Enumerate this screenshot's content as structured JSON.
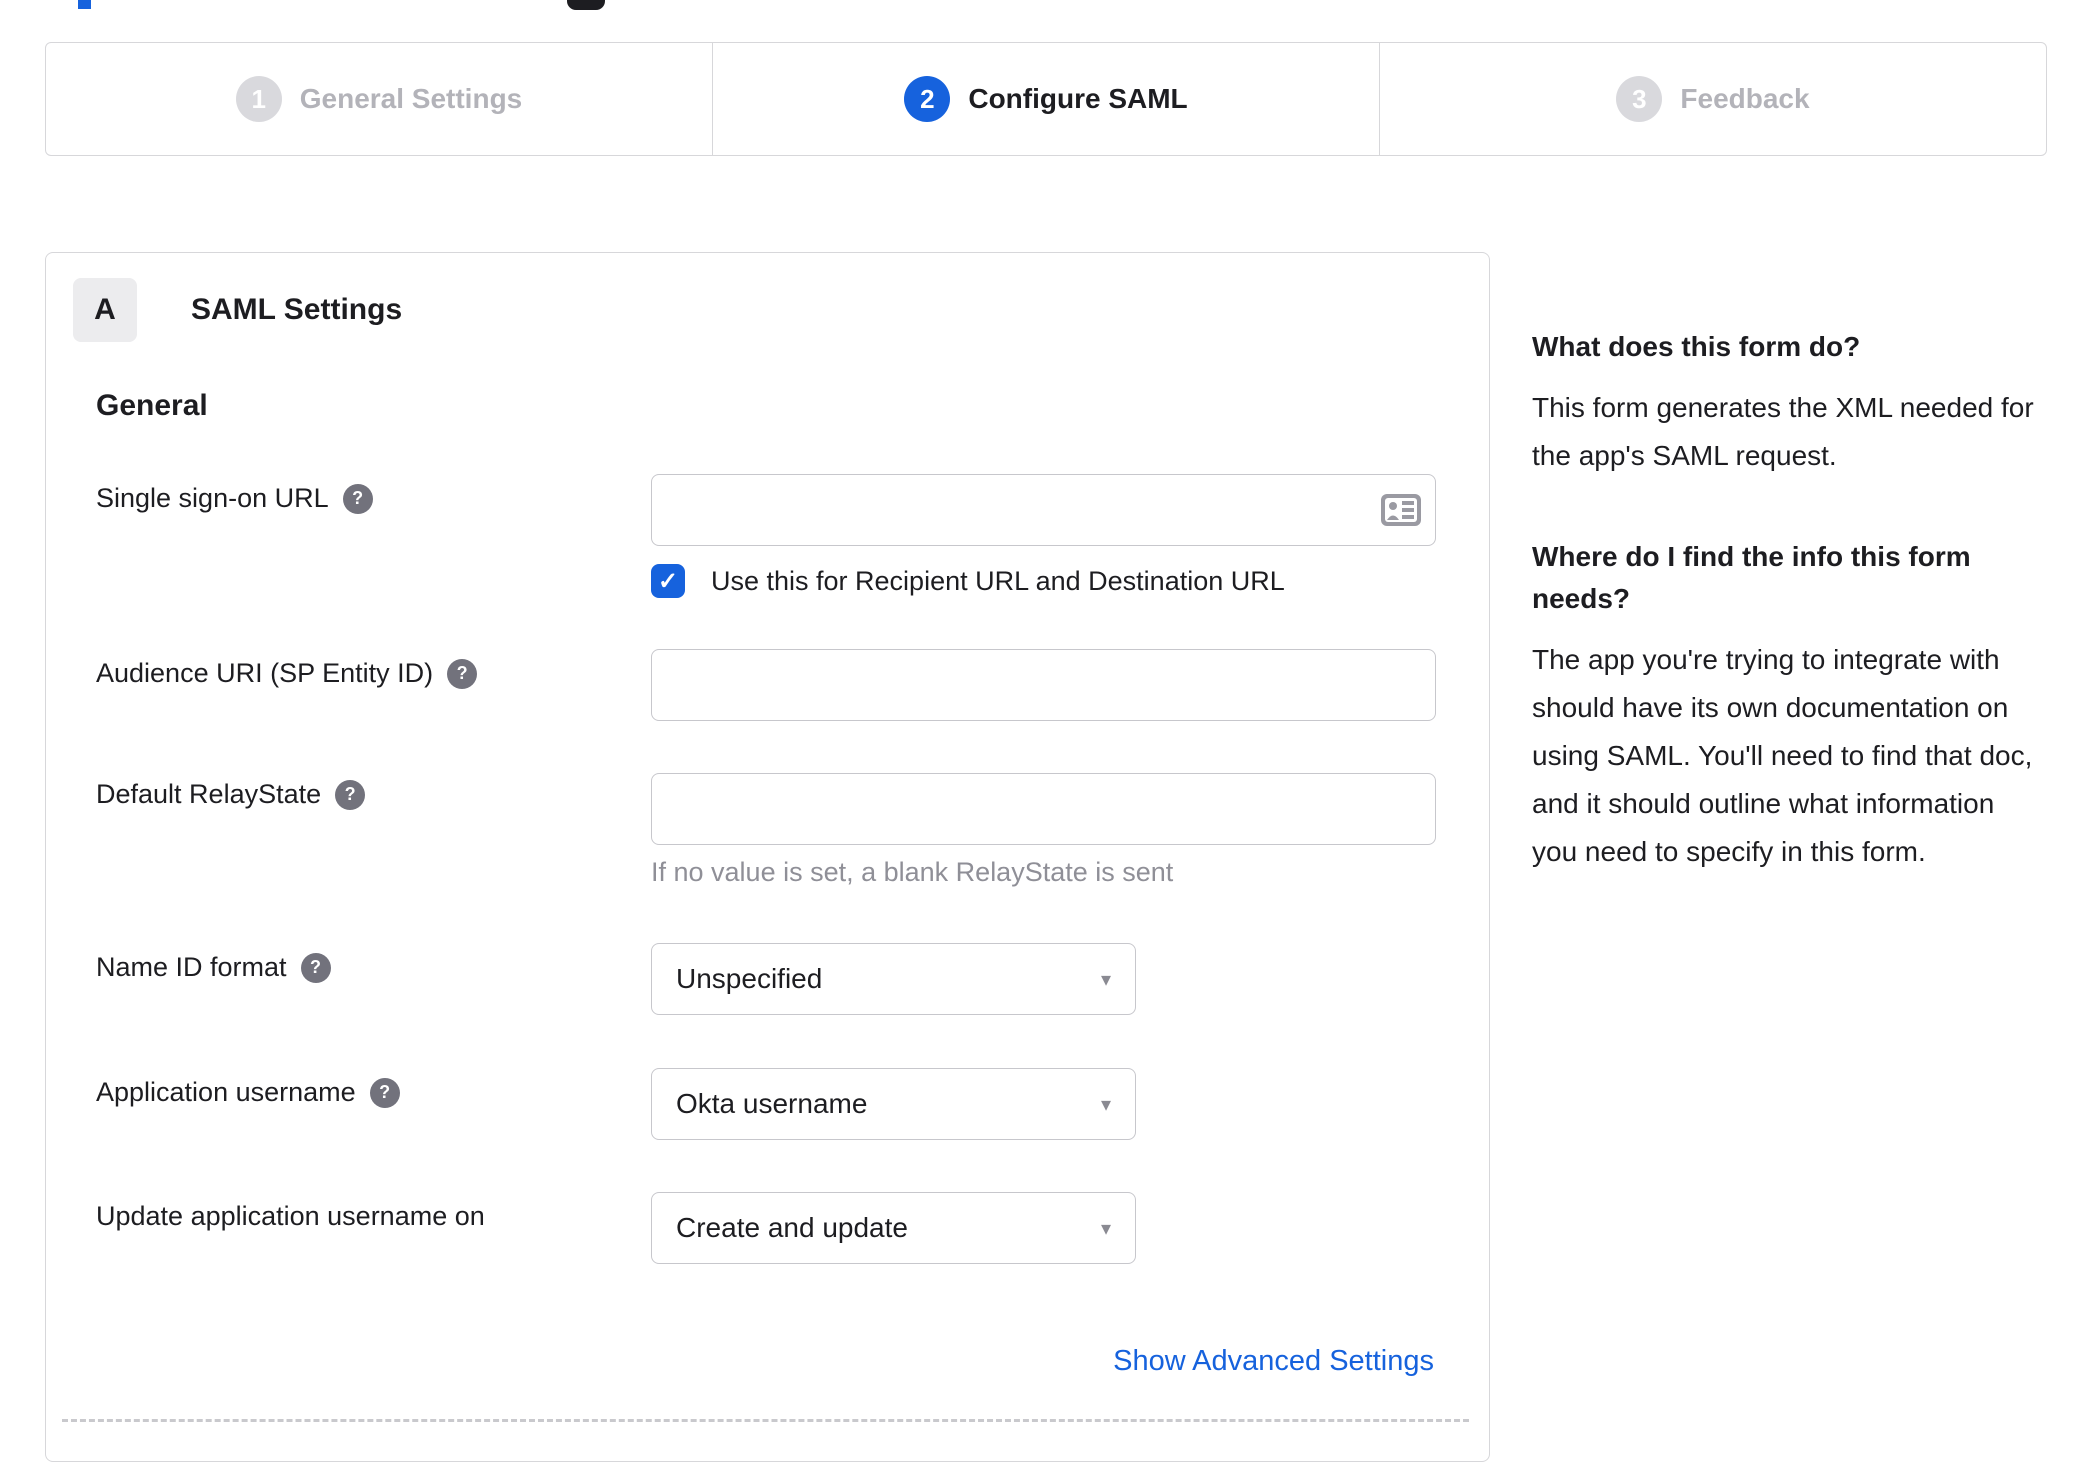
{
  "stepper": {
    "steps": [
      {
        "number": "1",
        "label": "General Settings",
        "state": "inactive"
      },
      {
        "number": "2",
        "label": "Configure SAML",
        "state": "active"
      },
      {
        "number": "3",
        "label": "Feedback",
        "state": "inactive"
      }
    ]
  },
  "panel": {
    "badge": "A",
    "title": "SAML Settings",
    "section_title": "General",
    "fields": {
      "sso_url": {
        "label": "Single sign-on URL",
        "value": "",
        "checkbox_label": "Use this for Recipient URL and Destination URL",
        "checkbox_checked": true
      },
      "audience_uri": {
        "label": "Audience URI (SP Entity ID)",
        "value": ""
      },
      "relay_state": {
        "label": "Default RelayState",
        "value": "",
        "helper": "If no value is set, a blank RelayState is sent"
      },
      "name_id_format": {
        "label": "Name ID format",
        "value": "Unspecified"
      },
      "app_username": {
        "label": "Application username",
        "value": "Okta username"
      },
      "update_app_username": {
        "label": "Update application username on",
        "value": "Create and update"
      }
    },
    "advanced_link": "Show Advanced Settings"
  },
  "sidebar": {
    "sections": [
      {
        "heading": "What does this form do?",
        "body": "This form generates the XML needed for the app's SAML request."
      },
      {
        "heading": "Where do I find the info this form needs?",
        "body": "The app you're trying to integrate with should have its own documentation on using SAML. You'll need to find that doc, and it should outline what information you need to specify in this form."
      }
    ]
  },
  "icons": {
    "help_glyph": "?",
    "check_glyph": "✓",
    "caret_glyph": "▾"
  },
  "colors": {
    "accent_blue": "#1662dd",
    "text_dark": "#1d1d21",
    "inactive_gray": "#b3b3b9",
    "border_gray": "#d7d7da",
    "helper_gray": "#8f8f97"
  }
}
